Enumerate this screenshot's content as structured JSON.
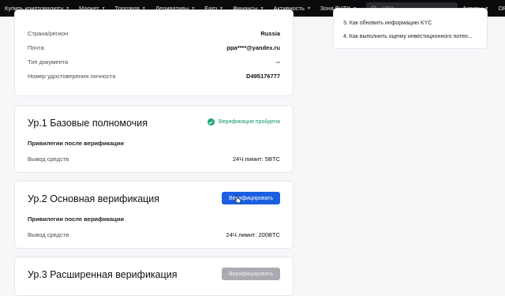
{
  "nav": {
    "items": [
      {
        "label": "Купить криптовалюту",
        "chevron": true
      },
      {
        "label": "Маркет",
        "chevron": true
      },
      {
        "label": "Торговля",
        "chevron": true
      },
      {
        "label": "Деривативы",
        "chevron": true
      },
      {
        "label": "Earn",
        "chevron": true
      },
      {
        "label": "Финансы",
        "chevron": true
      },
      {
        "label": "Активность",
        "chevron": true
      },
      {
        "label": "Зона $HTX",
        "chevron": true
      }
    ],
    "search_placeholder": "HTX",
    "right_items": [
      {
        "label": "Активы",
        "chevron": true
      },
      {
        "label": "ОРДЕРА",
        "chevron": true
      }
    ]
  },
  "identity": {
    "rows": [
      {
        "key": "Страна/регион",
        "value": "Russia"
      },
      {
        "key": "Почта",
        "value": "ppa****@yandex.ru"
      },
      {
        "key": "Тип документа",
        "value": "--"
      },
      {
        "key": "Номер удостоверения личности",
        "value": "D495176777"
      }
    ]
  },
  "levels": [
    {
      "title": "Ур.1 Базовые полномочия",
      "status": "Верификация пройдена",
      "privileges_label": "Привилегии после верификации",
      "withdraw_label": "Вывод средств",
      "withdraw_value": "24Ч лимит: 5BTC"
    },
    {
      "title": "Ур.2 Основная верификация",
      "button": "Верифицировать",
      "privileges_label": "Привилегии после верификации",
      "withdraw_label": "Вывод средств",
      "withdraw_value": "24Ч лимит: 200BTC"
    },
    {
      "title": "Ур.3 Расширенная верификация",
      "button": "Верифицировать"
    }
  ],
  "faq": {
    "items": [
      "3. Как обновить информацию KYC",
      "4. Как выполнить оценку инвестиционного потен..."
    ]
  },
  "colors": {
    "nav_bg": "#0b0b0e",
    "primary_button": "#1a5fe0",
    "disabled_button": "#a9abb0",
    "success": "#1aa56e"
  },
  "icons": [
    "chevron-down-icon",
    "search-icon",
    "check-circle-icon",
    "cursor-icon"
  ]
}
